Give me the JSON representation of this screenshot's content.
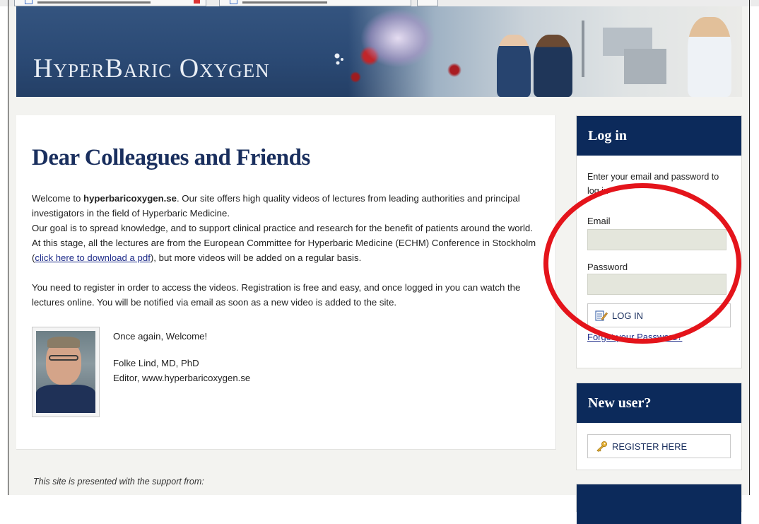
{
  "banner": {
    "title": "HyperBaric Oxygen"
  },
  "main": {
    "heading": "Dear Colleagues and Friends",
    "intro_prefix": "Welcome to ",
    "site_name": "hyperbaricoxygen.se",
    "intro_suffix": ". Our site offers high quality videos of lectures from leading authorities and principal investigators in the field of Hyperbaric Medicine.",
    "goal_text": "Our goal is to spread knowledge, and to support clinical practice and research for the benefit of patients around the world. At this stage, all the lectures are from the European Committee for Hyperbaric Medicine (ECHM) Conference in Stockholm (",
    "pdf_link": "click here to download a pdf",
    "goal_suffix": "), but more videos will be added on a regular basis.",
    "register_text": "You need to register in order to access the videos. Registration is free and easy, and once logged in you can watch the lectures online. You will be notified via email as soon as a new video is added to the site.",
    "welcome_again": "Once again, Welcome!",
    "signature_name": "Folke Lind, MD, PhD",
    "signature_role": "Editor, www.hyperbaricoxygen.se",
    "footer_support": "This site is presented with the support from:"
  },
  "login": {
    "title": "Log in",
    "intro": "Enter your email and password to log in",
    "email_label": "Email",
    "email_value": "",
    "password_label": "Password",
    "password_value": "",
    "button_label": "LOG IN",
    "forgot_link": "Forgot your Password?"
  },
  "new_user": {
    "title": "New user?",
    "button_label": "REGISTER HERE"
  },
  "colors": {
    "heading_navy": "#1a2f5e",
    "sidebar_header": "#0c2a5b",
    "annotation_red": "#e4141b",
    "input_bg": "#e4e6dc"
  },
  "icons": {
    "login_button": "edit-form-icon",
    "register_button": "key-icon"
  }
}
